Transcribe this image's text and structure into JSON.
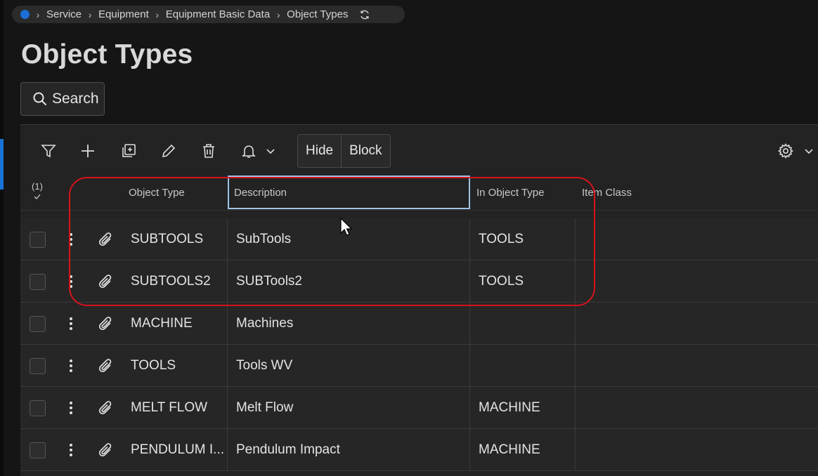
{
  "breadcrumb": {
    "items": [
      "Service",
      "Equipment",
      "Equipment Basic Data",
      "Object Types"
    ]
  },
  "page": {
    "title": "Object Types"
  },
  "search": {
    "label": "Search"
  },
  "toolbar": {
    "hide_label": "Hide",
    "block_label": "Block"
  },
  "table": {
    "selected_count": "(1)",
    "columns": [
      "Object Type",
      "Description",
      "In Object Type",
      "Item Class"
    ],
    "rows": [
      {
        "object_type": "SUBTOOLS",
        "description": "SubTools",
        "in_object_type": "TOOLS",
        "item_class": ""
      },
      {
        "object_type": "SUBTOOLS2",
        "description": "SUBTools2",
        "in_object_type": "TOOLS",
        "item_class": ""
      },
      {
        "object_type": "MACHINE",
        "description": "Machines",
        "in_object_type": "",
        "item_class": ""
      },
      {
        "object_type": "TOOLS",
        "description": "Tools WV",
        "in_object_type": "",
        "item_class": ""
      },
      {
        "object_type": "MELT FLOW",
        "description": "Melt Flow",
        "in_object_type": "MACHINE",
        "item_class": ""
      },
      {
        "object_type": "PENDULUM I...",
        "description": "Pendulum Impact",
        "in_object_type": "MACHINE",
        "item_class": ""
      }
    ]
  },
  "colors": {
    "accent": "#1b6fd6",
    "link": "#3a9ff0",
    "annotation": "#d7131c",
    "selected_header_border": "#9ec3e6"
  }
}
